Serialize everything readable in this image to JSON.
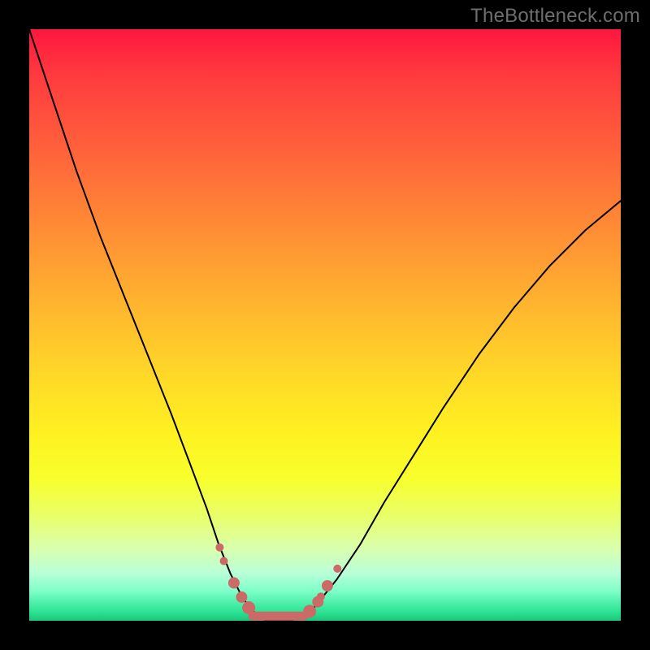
{
  "watermark": "TheBottleneck.com",
  "colors": {
    "background": "#000000",
    "curve": "#000000",
    "markers": "#cc6a68",
    "gradient_top": "#ff173f",
    "gradient_bottom": "#19c97b"
  },
  "chart_data": {
    "type": "line",
    "title": "",
    "xlabel": "",
    "ylabel": "",
    "xlim": [
      0,
      100
    ],
    "ylim": [
      0,
      100
    ],
    "grid": false,
    "series": [
      {
        "name": "bottleneck-curve",
        "x": [
          0,
          4,
          8,
          12,
          16,
          20,
          24,
          27,
          30,
          32,
          34,
          35.5,
          37,
          38.5,
          40,
          42,
          44,
          46,
          48,
          52,
          56,
          60,
          65,
          70,
          76,
          82,
          88,
          94,
          100
        ],
        "y": [
          100,
          88,
          76,
          65,
          55,
          45,
          35,
          27,
          19,
          13,
          8,
          5,
          2.5,
          1,
          0,
          0,
          0,
          0.5,
          2,
          7,
          13,
          20,
          28,
          36,
          45,
          53,
          60,
          66,
          71
        ],
        "note": "Values are percentages estimated from the image geometry; y=0 is optimum (green), y=100 is worst (red top). The curve descends steeply from the left, bottoms out around x≈38–46 (flat segment), then rises again toward the right with a shallower slope."
      }
    ],
    "markers": [
      {
        "x": 32.2,
        "y": 12.4,
        "r": 5
      },
      {
        "x": 32.9,
        "y": 10.1,
        "r": 5
      },
      {
        "x": 34.6,
        "y": 6.4,
        "r": 7
      },
      {
        "x": 35.9,
        "y": 4.0,
        "r": 7
      },
      {
        "x": 37.1,
        "y": 2.2,
        "r": 8
      },
      {
        "x": 47.4,
        "y": 1.6,
        "r": 8
      },
      {
        "x": 48.8,
        "y": 3.2,
        "r": 7
      },
      {
        "x": 49.3,
        "y": 4.1,
        "r": 5
      },
      {
        "x": 50.4,
        "y": 5.9,
        "r": 7
      },
      {
        "x": 52.1,
        "y": 8.8,
        "r": 5
      }
    ],
    "flat_segment": {
      "x_start": 37.8,
      "x_end": 46.4,
      "y": 0.8
    }
  }
}
